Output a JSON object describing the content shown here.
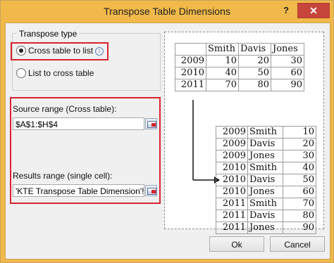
{
  "window": {
    "title": "Transpose Table Dimensions",
    "help_label": "?",
    "close_label": "✕"
  },
  "transpose_type": {
    "label": "Transpose type",
    "options": [
      {
        "label": "Cross table to list",
        "selected": true,
        "info_icon": "info-icon"
      },
      {
        "label": "List to cross table",
        "selected": false
      }
    ]
  },
  "source_range": {
    "label": "Source range (Cross table):",
    "value": "$A$1:$H$4"
  },
  "results_range": {
    "label": "Results range (single cell):",
    "value": "'KTE Transpose Table Dimension'!$A$"
  },
  "preview": {
    "cross_table": {
      "headers": [
        "",
        "Smith",
        "Davis",
        "Jones"
      ],
      "rows": [
        [
          "2009",
          "10",
          "20",
          "30"
        ],
        [
          "2010",
          "40",
          "50",
          "60"
        ],
        [
          "2011",
          "70",
          "80",
          "90"
        ]
      ]
    },
    "list_table": {
      "rows": [
        [
          "2009",
          "Smith",
          "10"
        ],
        [
          "2009",
          "Davis",
          "20"
        ],
        [
          "2009",
          "Jones",
          "30"
        ],
        [
          "2010",
          "Smith",
          "40"
        ],
        [
          "2010",
          "Davis",
          "50"
        ],
        [
          "2010",
          "Jones",
          "60"
        ],
        [
          "2011",
          "Smith",
          "70"
        ],
        [
          "2011",
          "Davis",
          "80"
        ],
        [
          "2011",
          "Jones",
          "90"
        ]
      ]
    }
  },
  "buttons": {
    "ok": "Ok",
    "cancel": "Cancel"
  },
  "colors": {
    "titlebar": "#f0b94a",
    "highlight": "#d9232f",
    "close_button": "#c7463c"
  }
}
